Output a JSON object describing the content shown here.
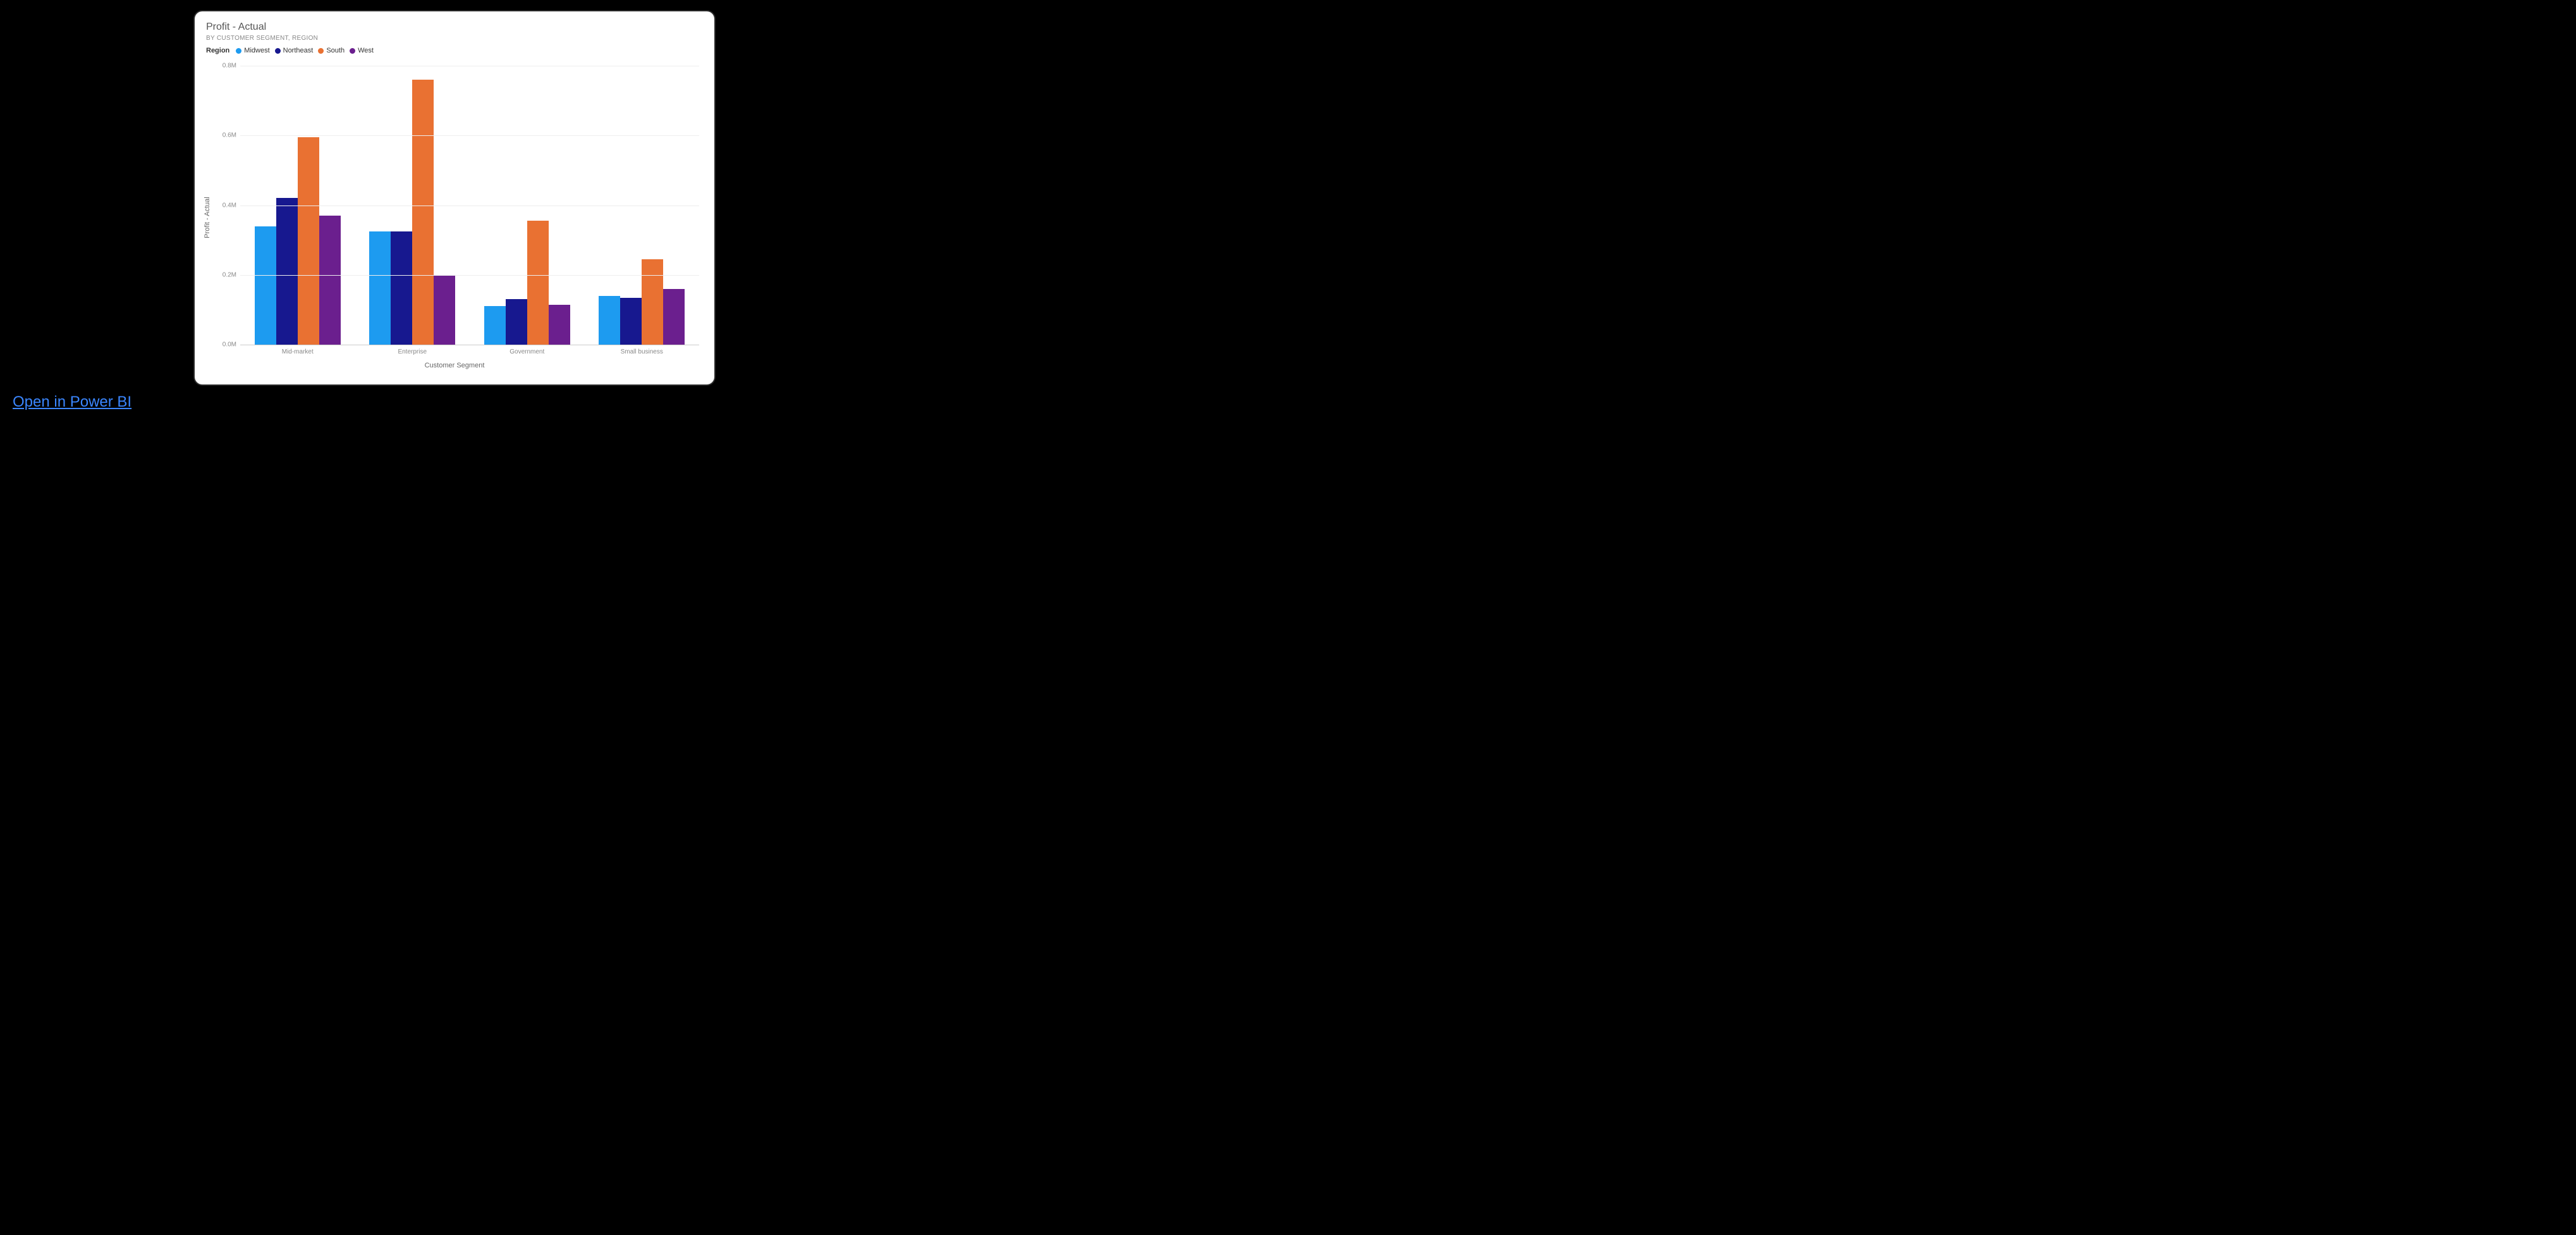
{
  "link": {
    "open_label": "Open in Power BI"
  },
  "chart_data": {
    "type": "bar",
    "title": "Profit - Actual",
    "subtitle": "BY CUSTOMER SEGMENT, REGION",
    "xlabel": "Customer Segment",
    "ylabel": "Profit - Actual",
    "ylim": [
      0,
      0.8
    ],
    "y_unit_suffix": "M",
    "y_ticks": [
      0.0,
      0.2,
      0.4,
      0.6,
      0.8
    ],
    "legend_title": "Region",
    "categories": [
      "Mid-market",
      "Enterprise",
      "Government",
      "Small business"
    ],
    "series": [
      {
        "name": "Midwest",
        "color": "#1d9bf0",
        "values": [
          0.34,
          0.325,
          0.11,
          0.14
        ]
      },
      {
        "name": "Northeast",
        "color": "#17188f",
        "values": [
          0.42,
          0.325,
          0.13,
          0.135
        ]
      },
      {
        "name": "South",
        "color": "#e97132",
        "values": [
          0.595,
          0.76,
          0.355,
          0.245
        ]
      },
      {
        "name": "West",
        "color": "#6b1f8e",
        "values": [
          0.37,
          0.2,
          0.115,
          0.16
        ]
      }
    ]
  }
}
